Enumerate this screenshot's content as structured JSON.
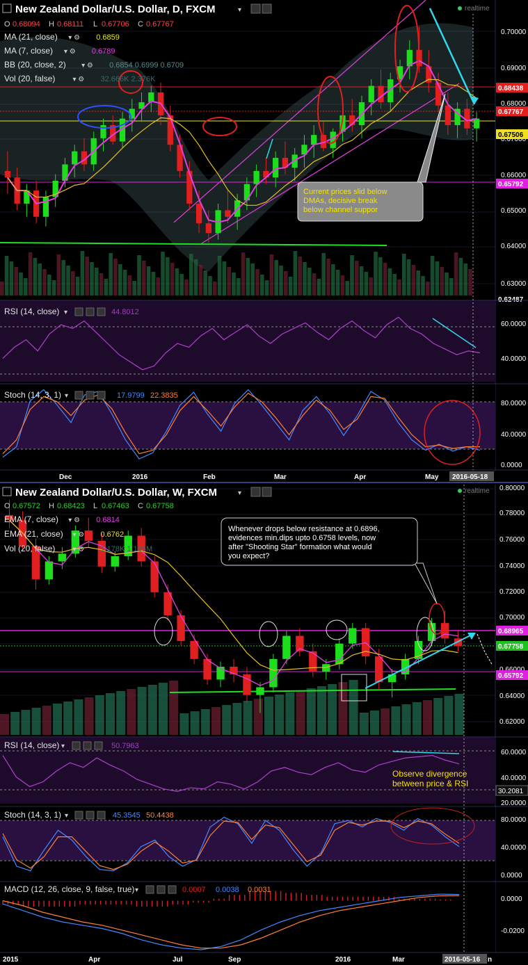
{
  "colors": {
    "background": "#000000",
    "panel_osc": "#1e0a2a",
    "up_candle": "#1ddd1d",
    "down_candle": "#e02020",
    "ma_fast": "#e040e0",
    "ma_slow": "#e8c020",
    "bollinger": "#6a8a8a",
    "rsi_line": "#b040d0",
    "stoch_k": "#4488ff",
    "stoch_d": "#ff8030",
    "macd_line": "#4488ff",
    "signal_line": "#ff8030",
    "channel": "#e040e0",
    "annotation_cyan": "#2fd8f0",
    "annotation_red": "#e02020",
    "support_green": "#20e020",
    "resistance_magenta": "#e020e0"
  },
  "top": {
    "title": "New Zealand Dollar/U.S. Dollar, D, FXCM",
    "realtime": "realtime",
    "ohlc": {
      "o_label": "O",
      "o": "0.68094",
      "h_label": "H",
      "h": "0.68111",
      "l_label": "L",
      "l": "0.67706",
      "c_label": "C",
      "c": "0.67767"
    },
    "legend": [
      {
        "label": "MA (21, close)",
        "value": "0.6859",
        "color": "#e8e820"
      },
      {
        "label": "MA (7, close)",
        "value": "0.6789",
        "color": "#e040e0"
      },
      {
        "label": "BB (20, close, 2)",
        "value": "0.6854  0.6999  0.6709",
        "color": "#5a8a8a"
      },
      {
        "label": "Vol (20, false)",
        "value": "32.666K  2.376K",
        "color": "#3a6a6a"
      }
    ],
    "price_axis": [
      "0.70000",
      "0.69000",
      "0.68000",
      "0.67000",
      "0.66000",
      "0.65000",
      "0.64000",
      "0.63000"
    ],
    "price_tags": [
      {
        "text": "0.68438",
        "bg": "#e02020",
        "fg": "#ffffff"
      },
      {
        "text": "0.67767",
        "bg": "#e02020",
        "fg": "#ffffff"
      },
      {
        "text": "0.67506",
        "bg": "#f0e020",
        "fg": "#000000"
      },
      {
        "text": "0.65792",
        "bg": "#e020e0",
        "fg": "#ffffff"
      },
      {
        "text": "0.62487",
        "bg": "#000000",
        "fg": "#ffffff"
      }
    ],
    "annotation": "Current prices slid below DMAs, decisive break below channel suppor",
    "annotation_lines": [
      "Current prices slid below",
      "DMAs, decisive break",
      "below channel suppor"
    ],
    "rsi": {
      "label": "RSI (14, close)",
      "value": "44.8012",
      "axis": [
        "60.0000",
        "40.0000"
      ]
    },
    "stoch": {
      "label": "Stoch (14, 3, 1)",
      "k": "17.9799",
      "d": "22.3835",
      "axis": [
        "80.0000",
        "40.0000",
        "0.0000"
      ]
    },
    "dates": [
      "Dec",
      "2016",
      "Feb",
      "Mar",
      "Apr",
      "May"
    ],
    "date_tag": "2016-05-18"
  },
  "bottom": {
    "title": "New Zealand Dollar/U.S. Dollar, W, FXCM",
    "realtime": "realtime",
    "ohlc": {
      "o_label": "O",
      "o": "0.67572",
      "h_label": "H",
      "h": "0.68423",
      "l_label": "L",
      "l": "0.67463",
      "c_label": "C",
      "c": "0.67758"
    },
    "legend": [
      {
        "label": "EMA (7, close)",
        "value": "0.6814",
        "color": "#e040e0"
      },
      {
        "label": "EMA (21, close)",
        "value": "0.6762",
        "color": "#e8e820"
      },
      {
        "label": "Vol (20, false)",
        "value": "1.178K  1.105M",
        "color": "#3a6a6a"
      }
    ],
    "price_axis": [
      "0.80000",
      "0.78000",
      "0.76000",
      "0.74000",
      "0.72000",
      "0.70000",
      "0.68000",
      "0.66000",
      "0.64000",
      "0.62000"
    ],
    "price_tags": [
      {
        "text": "0.68965",
        "bg": "#e020e0",
        "fg": "#ffffff"
      },
      {
        "text": "0.67758",
        "bg": "#20c020",
        "fg": "#ffffff"
      },
      {
        "text": "0.65792",
        "bg": "#e020e0",
        "fg": "#ffffff"
      }
    ],
    "callout_lines": [
      "Whenever drops below resistance at 0.6896,",
      "evidences min.dips upto 0.6758 levels, now",
      "after \"Shooting Star\" formation what would",
      "you expect?"
    ],
    "rsi": {
      "label": "RSI (14, close)",
      "value": "50.7963",
      "axis": [
        "60.0000",
        "40.0000",
        "30.2081",
        "20.0000"
      ]
    },
    "divergence_lines": [
      "Observe  divergence",
      "between price & RSI"
    ],
    "stoch": {
      "label": "Stoch (14, 3, 1)",
      "k": "45.3545",
      "d": "50.4438",
      "axis": [
        "80.0000",
        "40.0000",
        "0.0000"
      ]
    },
    "macd": {
      "label": "MACD (12, 26, close, 9, false, true)",
      "hist": "0.0007",
      "macd": "0.0038",
      "signal": "0.0031",
      "axis": [
        "0.0000",
        "-0.0200"
      ]
    },
    "dates": [
      "2015",
      "Apr",
      "Jul",
      "Sep",
      "2016",
      "Mar"
    ],
    "date_tag": "2016-05-16",
    "date_tag_suffix": "n"
  },
  "chart_data": [
    {
      "type": "candlestick",
      "title": "New Zealand Dollar/U.S. Dollar, D, FXCM",
      "ylim": [
        0.625,
        0.71
      ],
      "x_labels": [
        "Dec",
        "2016",
        "Feb",
        "Mar",
        "Apr",
        "May"
      ],
      "candles_ohlc": [
        [
          0.662,
          0.668,
          0.655,
          0.66
        ],
        [
          0.66,
          0.663,
          0.65,
          0.652
        ],
        [
          0.652,
          0.658,
          0.648,
          0.656
        ],
        [
          0.656,
          0.659,
          0.646,
          0.648
        ],
        [
          0.648,
          0.656,
          0.645,
          0.654
        ],
        [
          0.654,
          0.661,
          0.651,
          0.659
        ],
        [
          0.659,
          0.666,
          0.657,
          0.664
        ],
        [
          0.664,
          0.67,
          0.66,
          0.668
        ],
        [
          0.668,
          0.672,
          0.662,
          0.664
        ],
        [
          0.664,
          0.674,
          0.662,
          0.672
        ],
        [
          0.672,
          0.678,
          0.668,
          0.676
        ],
        [
          0.676,
          0.679,
          0.67,
          0.671
        ],
        [
          0.671,
          0.68,
          0.669,
          0.678
        ],
        [
          0.678,
          0.684,
          0.674,
          0.681
        ],
        [
          0.681,
          0.686,
          0.677,
          0.683
        ],
        [
          0.683,
          0.688,
          0.68,
          0.686
        ],
        [
          0.686,
          0.689,
          0.676,
          0.679
        ],
        [
          0.679,
          0.682,
          0.668,
          0.67
        ],
        [
          0.67,
          0.673,
          0.66,
          0.662
        ],
        [
          0.662,
          0.665,
          0.65,
          0.652
        ],
        [
          0.652,
          0.656,
          0.643,
          0.646
        ],
        [
          0.646,
          0.65,
          0.64,
          0.643
        ],
        [
          0.643,
          0.652,
          0.641,
          0.65
        ],
        [
          0.65,
          0.656,
          0.646,
          0.648
        ],
        [
          0.648,
          0.655,
          0.644,
          0.653
        ],
        [
          0.653,
          0.66,
          0.65,
          0.658
        ],
        [
          0.658,
          0.664,
          0.654,
          0.662
        ],
        [
          0.662,
          0.666,
          0.658,
          0.66
        ],
        [
          0.66,
          0.668,
          0.657,
          0.666
        ],
        [
          0.666,
          0.671,
          0.661,
          0.663
        ],
        [
          0.663,
          0.669,
          0.659,
          0.667
        ],
        [
          0.667,
          0.673,
          0.663,
          0.67
        ],
        [
          0.67,
          0.676,
          0.666,
          0.673
        ],
        [
          0.673,
          0.677,
          0.668,
          0.669
        ],
        [
          0.669,
          0.675,
          0.666,
          0.674
        ],
        [
          0.674,
          0.681,
          0.671,
          0.679
        ],
        [
          0.679,
          0.684,
          0.674,
          0.676
        ],
        [
          0.676,
          0.685,
          0.672,
          0.683
        ],
        [
          0.683,
          0.69,
          0.679,
          0.688
        ],
        [
          0.688,
          0.693,
          0.681,
          0.683
        ],
        [
          0.683,
          0.692,
          0.68,
          0.69
        ],
        [
          0.69,
          0.696,
          0.686,
          0.694
        ],
        [
          0.694,
          0.702,
          0.69,
          0.699
        ],
        [
          0.699,
          0.706,
          0.692,
          0.694
        ],
        [
          0.694,
          0.699,
          0.686,
          0.689
        ],
        [
          0.689,
          0.692,
          0.68,
          0.682
        ],
        [
          0.682,
          0.686,
          0.673,
          0.676
        ],
        [
          0.676,
          0.683,
          0.672,
          0.681
        ],
        [
          0.681,
          0.684,
          0.673,
          0.675
        ],
        [
          0.675,
          0.68,
          0.671,
          0.678
        ]
      ]
    },
    {
      "type": "line",
      "title": "RSI (14, close)",
      "ylim": [
        30,
        70
      ],
      "values": [
        42,
        48,
        52,
        46,
        55,
        60,
        58,
        62,
        56,
        50,
        44,
        40,
        36,
        38,
        45,
        50,
        48,
        54,
        58,
        52,
        56,
        60,
        54,
        50,
        55,
        58,
        61,
        56,
        52,
        58,
        62,
        57,
        53,
        60,
        64,
        58,
        55,
        50,
        47,
        44,
        46,
        45
      ]
    },
    {
      "type": "line",
      "title": "Stoch (14, 3, 1)",
      "ylim": [
        0,
        90
      ],
      "series": [
        {
          "name": "%K",
          "values": [
            10,
            22,
            75,
            88,
            70,
            50,
            82,
            86,
            60,
            30,
            8,
            15,
            40,
            70,
            85,
            60,
            40,
            72,
            88,
            70,
            50,
            30,
            64,
            80,
            60,
            35,
            58,
            86,
            76,
            50,
            30,
            18,
            25,
            17,
            22,
            18
          ]
        },
        {
          "name": "%D",
          "values": [
            14,
            30,
            65,
            80,
            74,
            58,
            76,
            82,
            66,
            38,
            14,
            18,
            36,
            64,
            80,
            64,
            46,
            68,
            84,
            74,
            56,
            36,
            58,
            76,
            64,
            42,
            54,
            80,
            78,
            56,
            36,
            22,
            24,
            20,
            22,
            22
          ]
        }
      ]
    },
    {
      "type": "candlestick",
      "title": "New Zealand Dollar/U.S. Dollar, W, FXCM",
      "ylim": [
        0.61,
        0.8
      ],
      "x_labels": [
        "2015",
        "Apr",
        "Jul",
        "Sep",
        "2016",
        "Mar"
      ],
      "candles_ohlc": [
        [
          0.78,
          0.792,
          0.77,
          0.776
        ],
        [
          0.776,
          0.783,
          0.752,
          0.756
        ],
        [
          0.756,
          0.762,
          0.722,
          0.73
        ],
        [
          0.73,
          0.748,
          0.726,
          0.744
        ],
        [
          0.744,
          0.755,
          0.738,
          0.75
        ],
        [
          0.75,
          0.772,
          0.747,
          0.768
        ],
        [
          0.768,
          0.778,
          0.755,
          0.76
        ],
        [
          0.76,
          0.766,
          0.735,
          0.74
        ],
        [
          0.74,
          0.752,
          0.736,
          0.748
        ],
        [
          0.748,
          0.768,
          0.745,
          0.764
        ],
        [
          0.764,
          0.77,
          0.74,
          0.744
        ],
        [
          0.744,
          0.748,
          0.716,
          0.72
        ],
        [
          0.72,
          0.726,
          0.698,
          0.702
        ],
        [
          0.702,
          0.706,
          0.678,
          0.682
        ],
        [
          0.682,
          0.687,
          0.664,
          0.668
        ],
        [
          0.668,
          0.672,
          0.648,
          0.652
        ],
        [
          0.652,
          0.666,
          0.646,
          0.662
        ],
        [
          0.662,
          0.668,
          0.65,
          0.656
        ],
        [
          0.656,
          0.662,
          0.634,
          0.64
        ],
        [
          0.64,
          0.65,
          0.626,
          0.646
        ],
        [
          0.646,
          0.672,
          0.642,
          0.668
        ],
        [
          0.668,
          0.69,
          0.664,
          0.686
        ],
        [
          0.686,
          0.692,
          0.67,
          0.674
        ],
        [
          0.674,
          0.68,
          0.654,
          0.658
        ],
        [
          0.658,
          0.668,
          0.652,
          0.664
        ],
        [
          0.664,
          0.684,
          0.66,
          0.68
        ],
        [
          0.68,
          0.696,
          0.676,
          0.692
        ],
        [
          0.692,
          0.696,
          0.664,
          0.67
        ],
        [
          0.67,
          0.676,
          0.644,
          0.65
        ],
        [
          0.65,
          0.66,
          0.638,
          0.656
        ],
        [
          0.656,
          0.672,
          0.652,
          0.668
        ],
        [
          0.668,
          0.686,
          0.664,
          0.682
        ],
        [
          0.682,
          0.7,
          0.678,
          0.696
        ],
        [
          0.696,
          0.706,
          0.68,
          0.684
        ],
        [
          0.684,
          0.69,
          0.674,
          0.678
        ]
      ]
    },
    {
      "type": "line",
      "title": "RSI (14, close)",
      "ylim": [
        20,
        70
      ],
      "values": [
        58,
        40,
        32,
        36,
        45,
        52,
        48,
        56,
        50,
        45,
        38,
        34,
        30,
        28,
        31,
        30,
        36,
        34,
        30,
        36,
        45,
        48,
        44,
        42,
        48,
        52,
        46,
        44,
        50,
        53,
        56,
        57,
        58,
        54,
        51
      ]
    },
    {
      "type": "line",
      "title": "Stoch (14, 3, 1)",
      "ylim": [
        0,
        100
      ],
      "series": [
        {
          "name": "%K",
          "values": [
            60,
            15,
            8,
            40,
            70,
            55,
            30,
            10,
            8,
            20,
            45,
            55,
            30,
            15,
            25,
            75,
            90,
            80,
            50,
            85,
            70,
            40,
            15,
            35,
            80,
            85,
            75,
            88,
            82,
            70,
            88,
            78,
            60,
            45
          ]
        },
        {
          "name": "%D",
          "values": [
            65,
            25,
            12,
            30,
            60,
            60,
            38,
            16,
            10,
            18,
            38,
            52,
            38,
            20,
            24,
            62,
            84,
            82,
            56,
            78,
            74,
            48,
            22,
            32,
            70,
            82,
            78,
            84,
            84,
            74,
            84,
            80,
            64,
            50
          ]
        }
      ]
    },
    {
      "type": "line",
      "title": "MACD (12, 26, close, 9, false, true)",
      "ylim": [
        -0.03,
        0.01
      ],
      "series": [
        {
          "name": "MACD",
          "values": [
            -0.002,
            -0.006,
            -0.01,
            -0.013,
            -0.015,
            -0.017,
            -0.02,
            -0.024,
            -0.027,
            -0.029,
            -0.03,
            -0.028,
            -0.024,
            -0.018,
            -0.013,
            -0.009,
            -0.006,
            -0.004,
            -0.002,
            0.0,
            0.002,
            0.003,
            0.004,
            0.0038
          ]
        },
        {
          "name": "Signal",
          "values": [
            0.0,
            -0.003,
            -0.007,
            -0.01,
            -0.013,
            -0.015,
            -0.018,
            -0.021,
            -0.024,
            -0.027,
            -0.029,
            -0.029,
            -0.027,
            -0.023,
            -0.018,
            -0.013,
            -0.009,
            -0.006,
            -0.004,
            -0.002,
            0.0,
            0.002,
            0.003,
            0.0031
          ]
        }
      ]
    }
  ]
}
